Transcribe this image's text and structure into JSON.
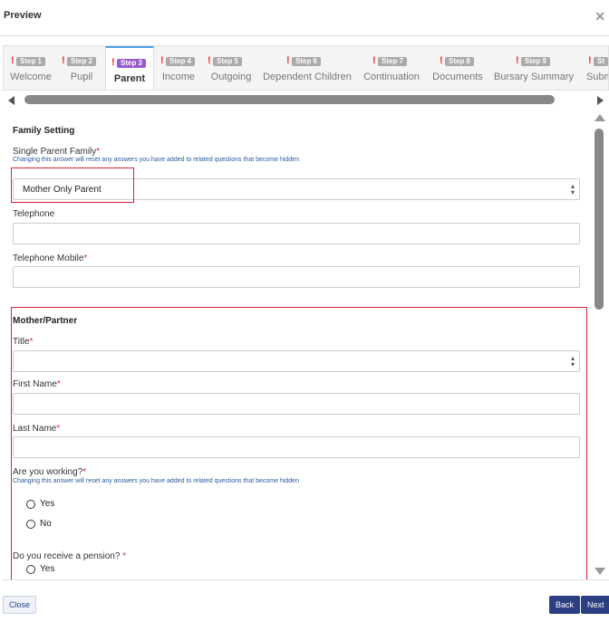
{
  "dialog": {
    "title": "Preview",
    "close_glyph": "✕"
  },
  "steps": [
    {
      "badge": "Step 1",
      "label": "Welcome",
      "warning": "!"
    },
    {
      "badge": "Step 2",
      "label": "Pupil",
      "warning": "!"
    },
    {
      "badge": "Step 3",
      "label": "Parent",
      "warning": "!",
      "active": true
    },
    {
      "badge": "Step 4",
      "label": "Income",
      "warning": "!"
    },
    {
      "badge": "Step 5",
      "label": "Outgoing",
      "warning": "!"
    },
    {
      "badge": "Step 6",
      "label": "Dependent Children",
      "warning": "!"
    },
    {
      "badge": "Step 7",
      "label": "Continuation",
      "warning": "!"
    },
    {
      "badge": "Step 8",
      "label": "Documents",
      "warning": "!"
    },
    {
      "badge": "Step 9",
      "label": "Bursary Summary",
      "warning": "!"
    },
    {
      "badge": "St",
      "label": "Subm",
      "warning": "!"
    }
  ],
  "family": {
    "section_title": "Family Setting",
    "single_parent_label": "Single Parent Family",
    "single_parent_hint": "Changing this answer will reset any answers you have added to related questions that become hidden",
    "single_parent_value": "Mother Only Parent",
    "telephone_label": "Telephone",
    "telephone_value": "",
    "mobile_label": "Telephone Mobile",
    "mobile_value": ""
  },
  "mother": {
    "section_title": "Mother/Partner",
    "title_label": "Title",
    "title_value": "",
    "first_name_label": "First Name",
    "first_name_value": "",
    "last_name_label": "Last Name",
    "last_name_value": "",
    "working_label": "Are you working?",
    "working_hint": "Changing this answer will reset any answers you have added to related questions that become hidden",
    "working_options": [
      "Yes",
      "No"
    ],
    "pension_label": "Do you receive a pension? ",
    "pension_options": [
      "Yes"
    ]
  },
  "required_marker": "*",
  "footer": {
    "close_label": "Close",
    "back_label": "Back",
    "next_label": "Next"
  },
  "colors": {
    "accent": "#2b3f82",
    "active_step_badge": "#9b59d0",
    "highlight_box": "#d9223a",
    "warning": "#e63030"
  }
}
